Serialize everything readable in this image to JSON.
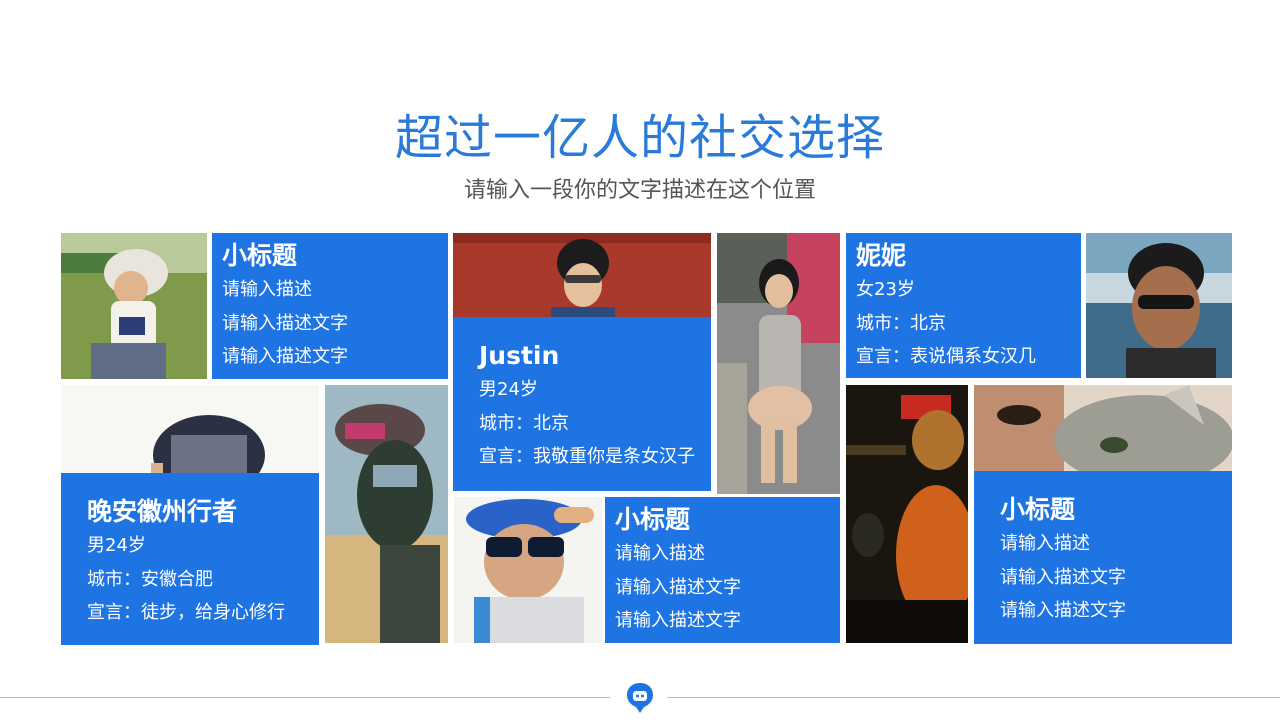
{
  "header": {
    "title": "超过一亿人的社交选择",
    "subtitle": "请输入一段你的文字描述在这个位置"
  },
  "cards": [
    {
      "title": "小标题",
      "lines": [
        "请输入描述",
        "请输入描述文字",
        "请输入描述文字"
      ]
    },
    {
      "title": "Justin",
      "lines": [
        "男24岁",
        "城市：北京",
        "宣言：我敬重你是条女汉子"
      ]
    },
    {
      "title": "妮妮",
      "lines": [
        "女23岁",
        "城市：北京",
        "宣言：表说偶系女汉几"
      ]
    },
    {
      "title": "晚安徽州行者",
      "lines": [
        "男24岁",
        "城市：安徽合肥",
        "宣言：徒步，给身心修行"
      ]
    },
    {
      "title": "小标题",
      "lines": [
        "请输入描述",
        "请输入描述文字",
        "请输入描述文字"
      ]
    },
    {
      "title": "小标题",
      "lines": [
        "请输入描述",
        "请输入描述文字",
        "请输入描述文字"
      ]
    }
  ],
  "photos": [
    "profile-photo-grass",
    "profile-photo-red-wall",
    "profile-photo-street",
    "profile-photo-beach",
    "profile-photo-cap-white",
    "profile-photo-cap-wind",
    "profile-photo-sunglasses",
    "profile-photo-dj",
    "profile-photo-cat"
  ],
  "colors": {
    "accent": "#1e74e2",
    "title": "#2a7ad8",
    "subtitle": "#555555",
    "footer_line": "#bcbcbc"
  },
  "footer": {
    "icon": "chat-bubble-icon"
  }
}
